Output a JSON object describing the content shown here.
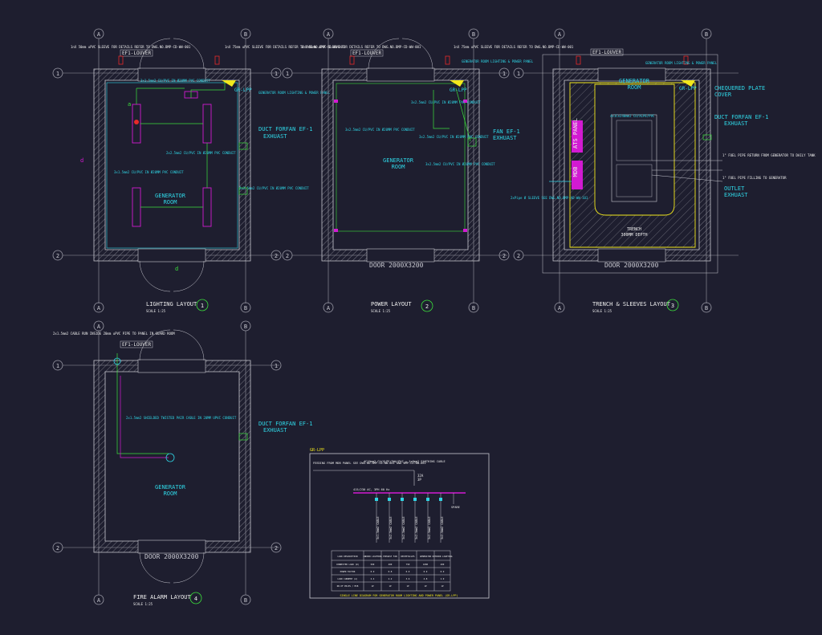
{
  "colors": {
    "background": "#1e1e2f",
    "wall": "#c8c8d0",
    "hatch": "#8a8a96",
    "cyan": "#2fd6e6",
    "green": "#3ce03c",
    "magenta": "#d21ad2",
    "yellow": "#f2e81c",
    "red": "#e82a2a",
    "white": "#eeeeee",
    "grid": "#9a9aa6",
    "title_circle": "#3ce03c"
  },
  "grid": {
    "col_a": "A",
    "col_b": "B",
    "row_1": "1",
    "row_2": "2"
  },
  "common": {
    "sleeve_note": "1nX 50mm uPVC SLEEVE FOR DETAILS REFER TO DWG.NO.BMP-CD-WW-001",
    "sleeve_note_b": "1nX 75mm uPVC SLEEVE FOR DETAILS REFER TO DWG.NO.BMP-CD-WW-001",
    "louver": "EF1-LOUVER",
    "door": "DOOR 2000X3200",
    "room1": "GENERATOR",
    "room2": "ROOM",
    "scale": "SCALE 1:25"
  },
  "lighting": {
    "title": "LIGHTING LAYOUT",
    "number": "1",
    "gr_lpp": "GR-LPP",
    "panel_note": "GENERATOR ROOM LIGHTING & POWER PANEL",
    "duct_fan": "DUCT FORFAN EF-1",
    "exhaust": "EXHUAST",
    "conduit_note": "3x1.5mm2 CU/PVC IN Ø20MM PVC CONDUIT",
    "conduit_note2": "2x2.5mm2 CU/PVC IN Ø20MM PVC CONDUIT",
    "lbl_a": "a",
    "lbl_b": "b",
    "lbl_d": "d"
  },
  "power": {
    "title": "POWER LAYOUT",
    "number": "2",
    "gr_lpp": "GR-LPP",
    "panel_note": "GENERATOR ROOM LIGHTING & POWER PANEL",
    "fan": "FAN EF-1",
    "exhaust": "EXHUAST",
    "conduit_note": "3x2.5mm2 CU/PVC IN Ø20MM PVC CONDUIT",
    "conduit_note2": "3x2.5mm2 CU/PVC IN Ø20MM PVC CONDUIT"
  },
  "trench": {
    "title": "TRENCH & SLEEVES LAYOUT",
    "number": "3",
    "gr_lpp": "GR-LPP",
    "chequered": "CHEQUERED PLATE",
    "cover": "COVER",
    "duct_fan": "DUCT FORFAN EF-1",
    "exhaust": "EXHUAST",
    "ats": "ATS PANEL",
    "mdb": "MDB",
    "trench1": "TRENCH",
    "trench2": "300MM DEPTH",
    "depth": "300MM DEPTH",
    "outlet": "OUTLET",
    "fuel_note": "1\" FUEL PIPE RETURN FROM GENERATOR TO DAILY TANK",
    "fuel_note2": "1\" FUEL PIPE FILLING TO GENERATOR",
    "panel_note": "GENERATOR ROOM LIGHTING & POWER PANEL",
    "cable_note": "4x1Cx240mm2 CU/XLPE/PVC",
    "sleeve_left": "2xPipe Ø SLEEVE SEE DWG.NO.BMP-AD-WW-101"
  },
  "fire": {
    "title": "FIRE ALARM LAYOUT",
    "number": "4",
    "duct_fan": "DUCT FORFAN EF-1",
    "exhaust": "EXHUAST",
    "cable_note": "2x1.5mm2 CABLE RUN INSIDE 20mm uPVC PIPE TO PANEL IN GUARD ROOM",
    "shield_note": "2x1.5mm2 SHIELDED TWISTED PAIR CABLE IN 20MM UPVC CONDUIT"
  },
  "schematic": {
    "header": "GR-LPP",
    "feeder": "FEEDING FROM MDB PANEL SEE DWG.NO.BMP-CD-WW-001 AND BMP-CD-WW-002",
    "cable": "4C10mm2 CU/XLPE/SWA/PVC + 1x6mm2 EARTHING CABLE",
    "breaker": "32A",
    "breaker_sub": "3P",
    "busbar": "415/230 AC, 3PH 60 Hz",
    "spare": "SPARE",
    "circuits": [
      "3x1.5mm2 CABLE",
      "3x2.5mm2 CABLE",
      "3x2.5mm2 CABLE",
      "3x2.5mm2 CABLE",
      "3x2.5mm2 CABLE",
      "3x2.5mm2 CABLE"
    ],
    "table_headers": [
      "LOAD DESCRIPTION",
      "INDOOR LIGHTING",
      "EXHAUST FAN",
      "RECEPTACLES",
      "GENERATOR",
      "OUTDOOR LIGHTING"
    ],
    "table_rows": [
      [
        "CONNECTED LOAD (W)",
        "500",
        "400",
        "750",
        "1000",
        "400"
      ],
      [
        "POWER FACTOR",
        "0.9",
        "0.8",
        "0.9",
        "0.9",
        "0.9"
      ],
      [
        "LOAD CURRENT (A)",
        "2.4",
        "2.2",
        "3.6",
        "4.8",
        "1.9"
      ],
      [
        "NO.OF POLES / MCB",
        "1P",
        "1P",
        "1P",
        "1P",
        "1P"
      ]
    ],
    "footer": "SINGLE LINE DIAGRAM FOR GENERATOR ROOM LIGHTING AND POWER PANEL (GR-LPP)"
  }
}
